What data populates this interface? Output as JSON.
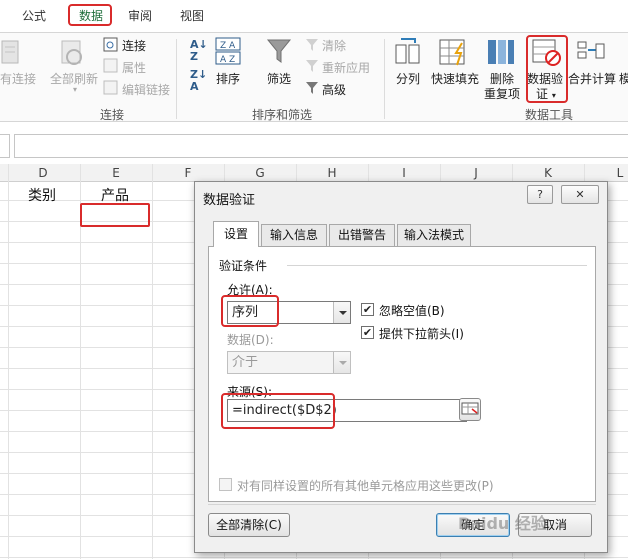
{
  "ribbon": {
    "tabs": [
      "公式",
      "数据",
      "审阅",
      "视图"
    ],
    "active_tab": "数据",
    "connections": {
      "existing_label": "有连接",
      "refresh_all_label": "全部刷新",
      "connect_label": "连接",
      "properties_label": "属性",
      "edit_links_label": "编辑链接",
      "group_label": "连接"
    },
    "sort_filter": {
      "sort_label": "排序",
      "filter_label": "筛选",
      "clear_label": "清除",
      "reapply_label": "重新应用",
      "advanced_label": "高级",
      "group_label": "排序和筛选"
    },
    "data_tools": {
      "split_label": "分列",
      "flash_fill_label": "快速填充",
      "remove_dup_label_1": "删除",
      "remove_dup_label_2": "重复项",
      "validation_label_1": "数据验",
      "validation_label_2": "证",
      "consolidate_label": "合并计算",
      "extra_label": "模",
      "group_label": "数据工具"
    }
  },
  "sheet": {
    "columns": [
      "D",
      "E",
      "F",
      "G",
      "H",
      "I",
      "J",
      "K",
      "L"
    ],
    "cells": {
      "d1": "类别",
      "e1": "产品"
    }
  },
  "dialog": {
    "title": "数据验证",
    "help_btn": "?",
    "close_btn": "✕",
    "tabs": [
      "设置",
      "输入信息",
      "出错警告",
      "输入法模式"
    ],
    "active_tab": "设置",
    "section_title": "验证条件",
    "allow_label": "允许(A):",
    "allow_value": "序列",
    "ignore_blank_label": "忽略空值(B)",
    "ignore_blank_checked": true,
    "dropdown_label": "提供下拉箭头(I)",
    "dropdown_checked": true,
    "data_label": "数据(D):",
    "data_value": "介于",
    "source_label": "来源(S):",
    "source_value": "=indirect($D$2)",
    "apply_all_label": "对有同样设置的所有其他单元格应用这些更改(P)",
    "apply_all_checked": false,
    "clear_all_label": "全部清除(C)",
    "ok_label": "确定",
    "cancel_label": "取消"
  },
  "watermark": "Baidu 经验",
  "colors": {
    "highlight": "#d92b2b",
    "excel_green": "#1e6e3a"
  }
}
